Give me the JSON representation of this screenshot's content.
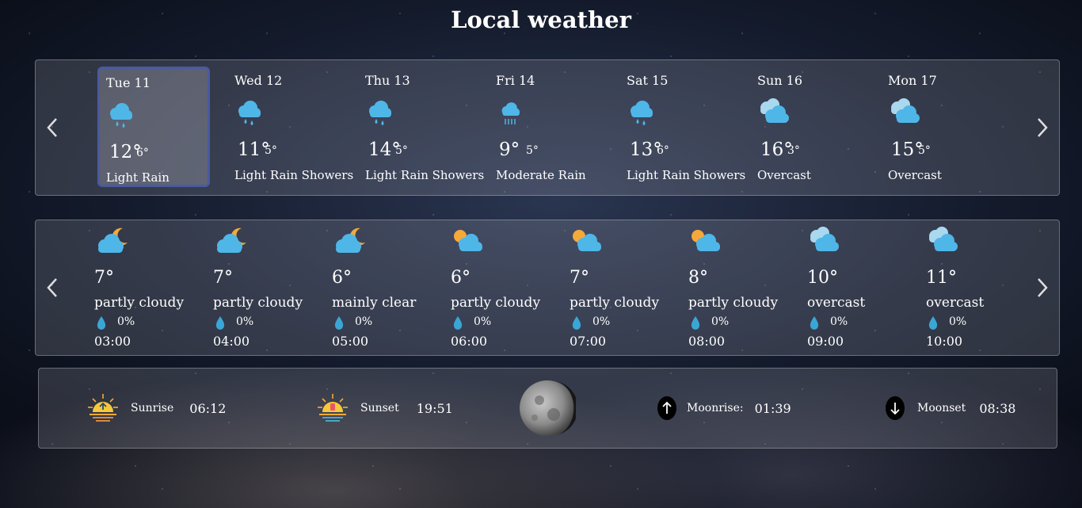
{
  "page": {
    "title": "Local weather"
  },
  "daily": [
    {
      "day": "Tue 11",
      "high": "12°",
      "low": "6°",
      "condition": "Light Rain",
      "icon": "light-rain-icon"
    },
    {
      "day": "Wed 12",
      "high": "11°",
      "low": "5°",
      "condition": "Light Rain Showers",
      "icon": "light-rain-icon"
    },
    {
      "day": "Thu 13",
      "high": "14°",
      "low": "5°",
      "condition": "Light Rain Showers",
      "icon": "light-rain-icon"
    },
    {
      "day": "Fri 14",
      "high": "9°",
      "low": "5°",
      "condition": "Moderate Rain",
      "icon": "moderate-rain-icon"
    },
    {
      "day": "Sat 15",
      "high": "13°",
      "low": "6°",
      "condition": "Light Rain Showers",
      "icon": "light-rain-icon"
    },
    {
      "day": "Sun 16",
      "high": "16°",
      "low": "3°",
      "condition": "Overcast",
      "icon": "overcast-icon"
    },
    {
      "day": "Mon 17",
      "high": "15°",
      "low": "5°",
      "condition": "Overcast",
      "icon": "overcast-icon"
    }
  ],
  "hourly": [
    {
      "temp": "7°",
      "condition": "partly cloudy",
      "precip": "0%",
      "time": "03:00",
      "icon": "cloud-moon-icon"
    },
    {
      "temp": "7°",
      "condition": "partly cloudy",
      "precip": "0%",
      "time": "04:00",
      "icon": "cloud-moon-icon"
    },
    {
      "temp": "6°",
      "condition": "mainly clear",
      "precip": "0%",
      "time": "05:00",
      "icon": "cloud-moon-icon"
    },
    {
      "temp": "6°",
      "condition": "partly cloudy",
      "precip": "0%",
      "time": "06:00",
      "icon": "cloud-sun-icon"
    },
    {
      "temp": "7°",
      "condition": "partly cloudy",
      "precip": "0%",
      "time": "07:00",
      "icon": "cloud-sun-icon"
    },
    {
      "temp": "8°",
      "condition": "partly cloudy",
      "precip": "0%",
      "time": "08:00",
      "icon": "cloud-sun-icon"
    },
    {
      "temp": "10°",
      "condition": "overcast",
      "precip": "0%",
      "time": "09:00",
      "icon": "overcast-icon"
    },
    {
      "temp": "11°",
      "condition": "overcast",
      "precip": "0%",
      "time": "10:00",
      "icon": "overcast-icon"
    }
  ],
  "astro": {
    "sunrise_label": "Sunrise",
    "sunrise": "06:12",
    "sunset_label": "Sunset",
    "sunset": "19:51",
    "moonrise_label": "Moonrise:",
    "moonrise": "01:39",
    "moonset_label": "Moonset",
    "moonset": "08:38"
  },
  "colors": {
    "accent": "#4a5aa0",
    "cloud": "#4fb6e8",
    "moon": "#f4a93a",
    "drop": "#3aa6d6",
    "sun": "#f6c93a"
  }
}
